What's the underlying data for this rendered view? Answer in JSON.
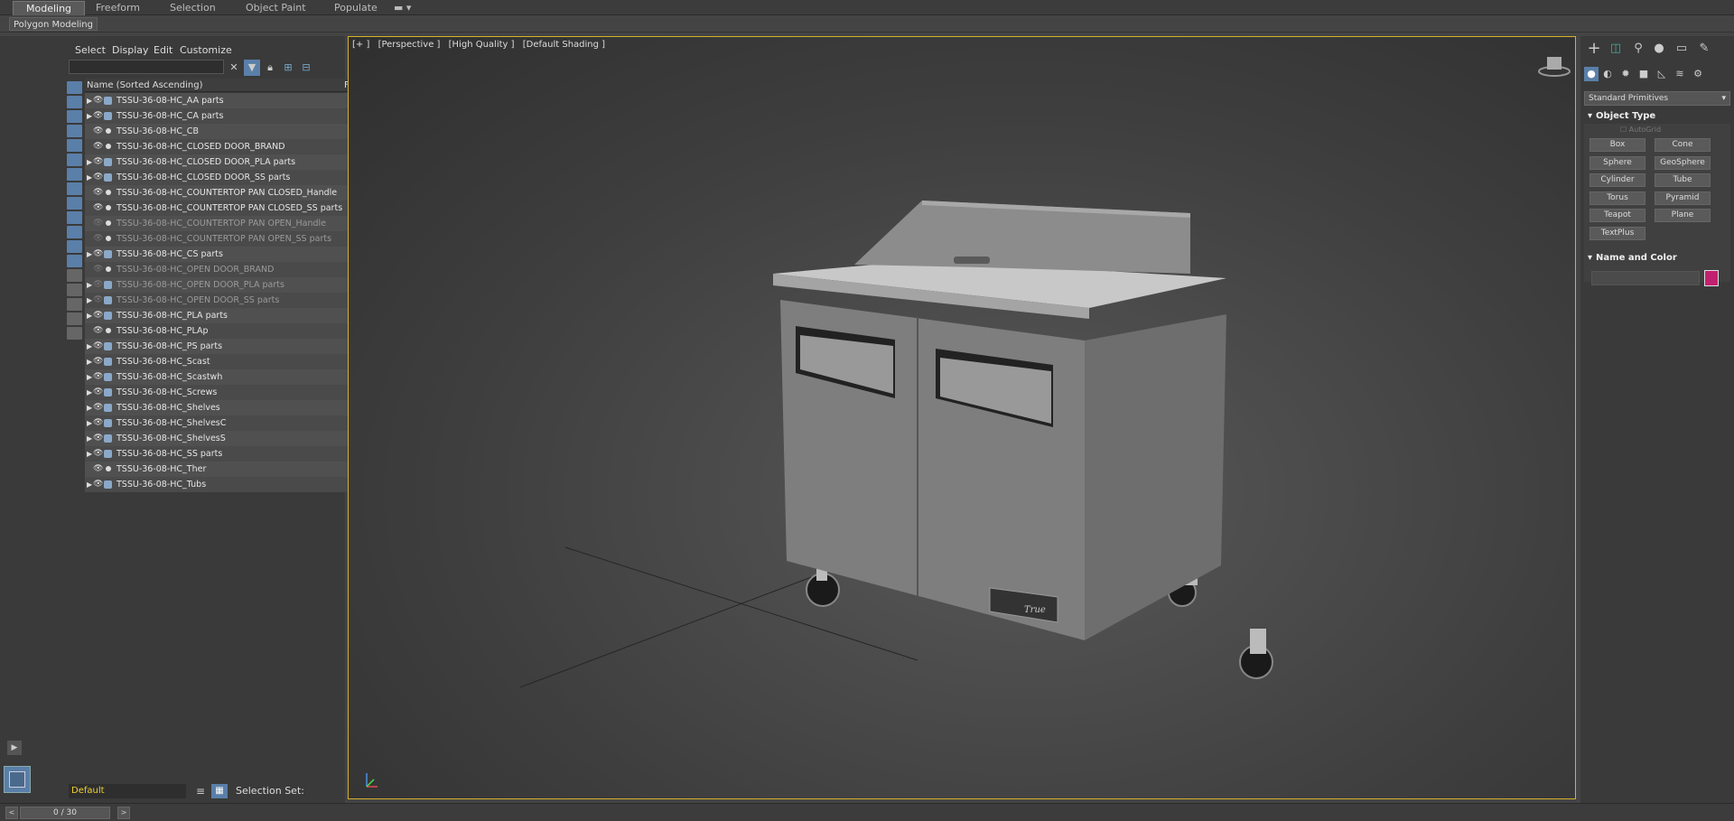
{
  "ribbon": {
    "tabs": [
      {
        "label": "Modeling",
        "active": true
      },
      {
        "label": "Freeform"
      },
      {
        "label": "Selection"
      },
      {
        "label": "Object Paint"
      },
      {
        "label": "Populate"
      }
    ],
    "sub_label": "Polygon Modeling"
  },
  "explorer": {
    "menu": [
      "Select",
      "Display",
      "Edit",
      "Customize"
    ],
    "search_placeholder": "",
    "column_name": "Name (Sorted Ascending)",
    "column_frozen": "Fro",
    "rows": [
      {
        "label": "TSSU-36-08-HC_AA parts",
        "expand": true,
        "type": "group",
        "dim": false
      },
      {
        "label": "TSSU-36-08-HC_CA parts",
        "expand": true,
        "type": "group",
        "dim": false
      },
      {
        "label": "TSSU-36-08-HC_CB",
        "expand": false,
        "type": "object",
        "dim": false
      },
      {
        "label": "TSSU-36-08-HC_CLOSED DOOR_BRAND",
        "expand": false,
        "type": "object",
        "dim": false
      },
      {
        "label": "TSSU-36-08-HC_CLOSED DOOR_PLA parts",
        "expand": true,
        "type": "group",
        "dim": false
      },
      {
        "label": "TSSU-36-08-HC_CLOSED DOOR_SS parts",
        "expand": true,
        "type": "group",
        "dim": false
      },
      {
        "label": "TSSU-36-08-HC_COUNTERTOP PAN CLOSED_Handle",
        "expand": false,
        "type": "object",
        "dim": false
      },
      {
        "label": "TSSU-36-08-HC_COUNTERTOP PAN CLOSED_SS parts",
        "expand": false,
        "type": "object",
        "dim": false
      },
      {
        "label": "TSSU-36-08-HC_COUNTERTOP PAN OPEN_Handle",
        "expand": false,
        "type": "object",
        "dim": true
      },
      {
        "label": "TSSU-36-08-HC_COUNTERTOP PAN OPEN_SS parts",
        "expand": false,
        "type": "object",
        "dim": true
      },
      {
        "label": "TSSU-36-08-HC_CS parts",
        "expand": true,
        "type": "group",
        "dim": false
      },
      {
        "label": "TSSU-36-08-HC_OPEN DOOR_BRAND",
        "expand": false,
        "type": "object",
        "dim": true
      },
      {
        "label": "TSSU-36-08-HC_OPEN DOOR_PLA parts",
        "expand": true,
        "type": "group",
        "dim": true
      },
      {
        "label": "TSSU-36-08-HC_OPEN DOOR_SS parts",
        "expand": true,
        "type": "group",
        "dim": true
      },
      {
        "label": "TSSU-36-08-HC_PLA parts",
        "expand": true,
        "type": "group",
        "dim": false
      },
      {
        "label": "TSSU-36-08-HC_PLAp",
        "expand": false,
        "type": "object",
        "dim": false
      },
      {
        "label": "TSSU-36-08-HC_PS parts",
        "expand": true,
        "type": "group",
        "dim": false
      },
      {
        "label": "TSSU-36-08-HC_Scast",
        "expand": true,
        "type": "group",
        "dim": false
      },
      {
        "label": "TSSU-36-08-HC_Scastwh",
        "expand": true,
        "type": "group",
        "dim": false
      },
      {
        "label": "TSSU-36-08-HC_Screws",
        "expand": true,
        "type": "group",
        "dim": false
      },
      {
        "label": "TSSU-36-08-HC_Shelves",
        "expand": true,
        "type": "group",
        "dim": false
      },
      {
        "label": "TSSU-36-08-HC_ShelvesC",
        "expand": true,
        "type": "group",
        "dim": false
      },
      {
        "label": "TSSU-36-08-HC_ShelvesS",
        "expand": true,
        "type": "group",
        "dim": false
      },
      {
        "label": "TSSU-36-08-HC_SS parts",
        "expand": true,
        "type": "group",
        "dim": false
      },
      {
        "label": "TSSU-36-08-HC_Ther",
        "expand": false,
        "type": "object",
        "dim": false
      },
      {
        "label": "TSSU-36-08-HC_Tubs",
        "expand": true,
        "type": "group",
        "dim": false
      }
    ],
    "layer": "Default",
    "selection_set": "Selection Set:"
  },
  "viewport": {
    "labels": [
      "[+ ]",
      "[Perspective ]",
      "[High Quality ]",
      "[Default Shading ]"
    ],
    "active_border_color": "#d4b12a",
    "brand_logo": "True"
  },
  "command_panel": {
    "dropdown": "Standard Primitives",
    "object_type_title": "Object Type",
    "autogrid": "AutoGrid",
    "buttons": [
      "Box",
      "Cone",
      "Sphere",
      "GeoSphere",
      "Cylinder",
      "Tube",
      "Torus",
      "Pyramid",
      "Teapot",
      "Plane",
      "TextPlus"
    ],
    "name_color_title": "Name and Color",
    "swatch_color": "#c2216f"
  },
  "status": {
    "frame": "0 / 30"
  }
}
